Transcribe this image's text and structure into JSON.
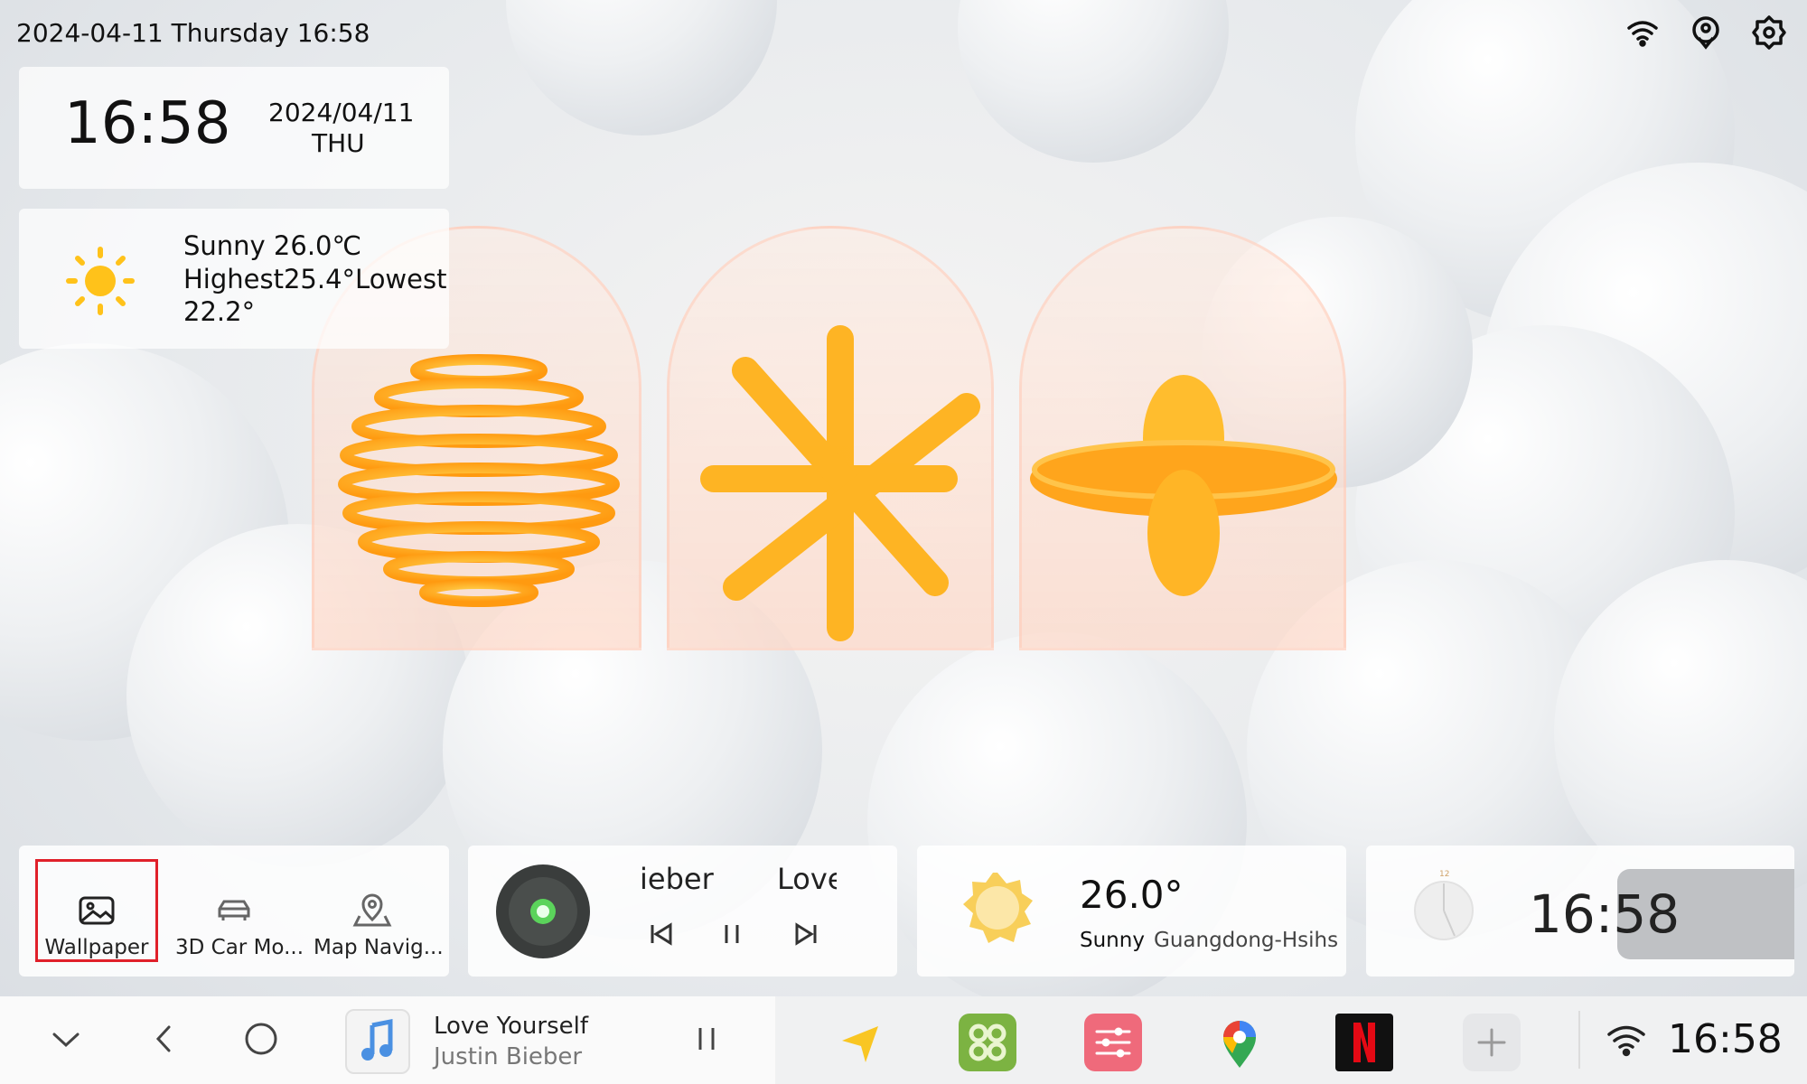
{
  "status_bar": {
    "datetime": "2024-04-11 Thursday 16:58",
    "icons": [
      "wifi-icon",
      "location-icon",
      "settings-icon"
    ]
  },
  "clock_widget": {
    "time": "16:58",
    "date": "2024/04/11",
    "weekday": "THU"
  },
  "weather_widget": {
    "line1": "Sunny  26.0℃",
    "line2": "Highest25.4°Lowest",
    "line3": "22.2°",
    "icon": "sun-icon"
  },
  "shortcuts": [
    {
      "label": "Wallpaper",
      "icon": "wallpaper-icon",
      "selected": true
    },
    {
      "label": "3D Car Mo...",
      "icon": "car-icon",
      "selected": false
    },
    {
      "label": "Map Navig...",
      "icon": "map-pin-icon",
      "selected": false
    }
  ],
  "music_widget": {
    "artist_scroll": "ieber",
    "title_scroll": "Love"
  },
  "weather_card": {
    "temperature": "26.0°",
    "condition": "Sunny",
    "location": "Guangdong-Hsihs"
  },
  "analog_clock_widget": {
    "marker": "12",
    "time": "16:58"
  },
  "navbar": {
    "now_playing_title": "Love Yourself",
    "now_playing_artist": "Justin Bieber",
    "time": "16:58",
    "dock_apps": [
      "navigation-icon",
      "apps-icon",
      "equalizer-icon",
      "google-maps-icon",
      "netflix-icon",
      "add-icon"
    ]
  },
  "colors": {
    "accent_red": "#e0202a",
    "orange": "#ffb01e",
    "music_green": "#5bd35b",
    "netflix_red": "#e50914",
    "apps_green": "#7cb342",
    "eq_pink": "#ef6a7b"
  }
}
